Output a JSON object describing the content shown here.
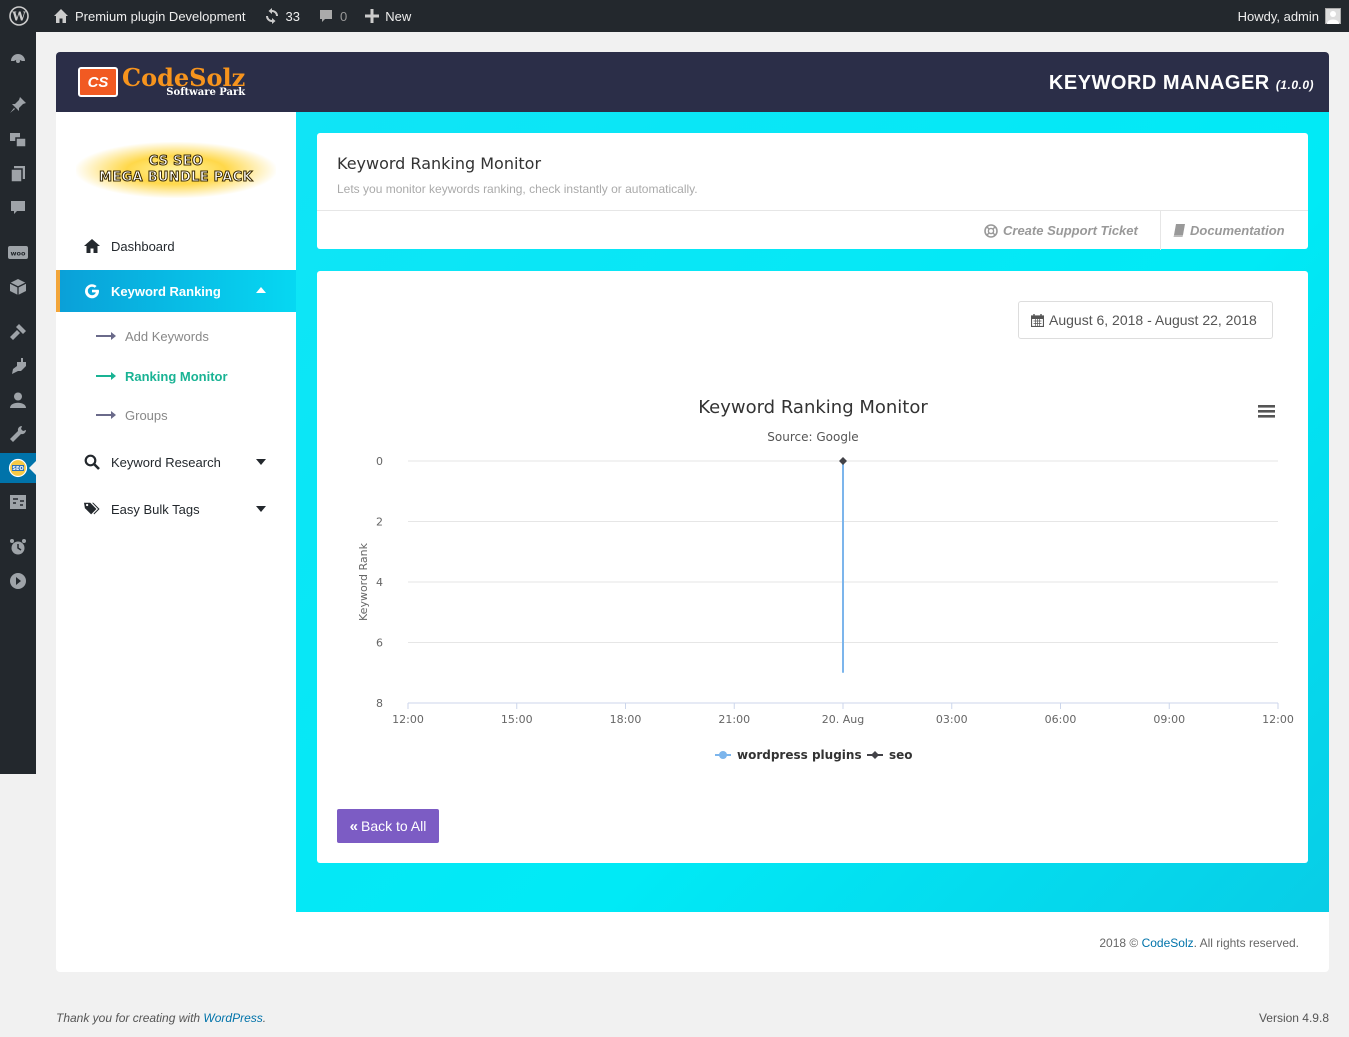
{
  "adminbar": {
    "site_name": "Premium plugin Development",
    "updates_count": "33",
    "comments_count": "0",
    "new_label": "New",
    "howdy": "Howdy, admin"
  },
  "header": {
    "logo_name": "CodeSolz",
    "logo_tag": "Software Park",
    "logo_mark": "CS",
    "title": "KEYWORD MANAGER",
    "version": "(1.0.0)"
  },
  "sidebar": {
    "bundle_line1": "CS SEO",
    "bundle_line2": "MEGA BUNDLE PACK",
    "items": [
      {
        "label": "Dashboard"
      },
      {
        "label": "Keyword Ranking"
      },
      {
        "label": "Keyword Research"
      },
      {
        "label": "Easy Bulk Tags"
      }
    ],
    "subitems": [
      {
        "label": "Add Keywords"
      },
      {
        "label": "Ranking Monitor"
      },
      {
        "label": "Groups"
      }
    ]
  },
  "page": {
    "title": "Keyword Ranking Monitor",
    "subtitle": "Lets you monitor keywords ranking, check instantly or automatically.",
    "support_link": "Create Support Ticket",
    "docs_link": "Documentation",
    "date_range": "August 6, 2018 - August 22, 2018",
    "back_button": "Back to All"
  },
  "chart_data": {
    "type": "line",
    "title": "Keyword Ranking Monitor",
    "subtitle": "Source: Google",
    "ylabel": "Keyword Rank",
    "ylim": [
      0,
      8
    ],
    "y_reversed": true,
    "yticks": [
      "0",
      "2",
      "4",
      "6",
      "8"
    ],
    "xticks": [
      "12:00",
      "15:00",
      "18:00",
      "21:00",
      "20. Aug",
      "03:00",
      "06:00",
      "09:00",
      "12:00"
    ],
    "series": [
      {
        "name": "wordpress plugins",
        "color": "#7cb5ec",
        "points": [
          {
            "x": "20. Aug 00:00",
            "y": 0
          },
          {
            "x": "20. Aug 00:00",
            "y": 7
          }
        ]
      },
      {
        "name": "seo",
        "color": "#434348",
        "points": [
          {
            "x": "20. Aug 00:00",
            "y": 0
          }
        ]
      }
    ],
    "legend": "bottom-center",
    "grid": true
  },
  "footer": {
    "copy_prefix": "2018 © ",
    "copy_link": "CodeSolz",
    "copy_suffix": ". All rights reserved.",
    "wp_thanks": "Thank you for creating with ",
    "wp_link": "WordPress",
    "wp_period": ".",
    "wp_version": "Version 4.9.8"
  },
  "colors": {
    "accent": "#06d8f2",
    "topbar": "#2b2e48",
    "active_border": "#f2a53a",
    "submenu_active": "#19b394",
    "back_button": "#7c5cc4"
  }
}
